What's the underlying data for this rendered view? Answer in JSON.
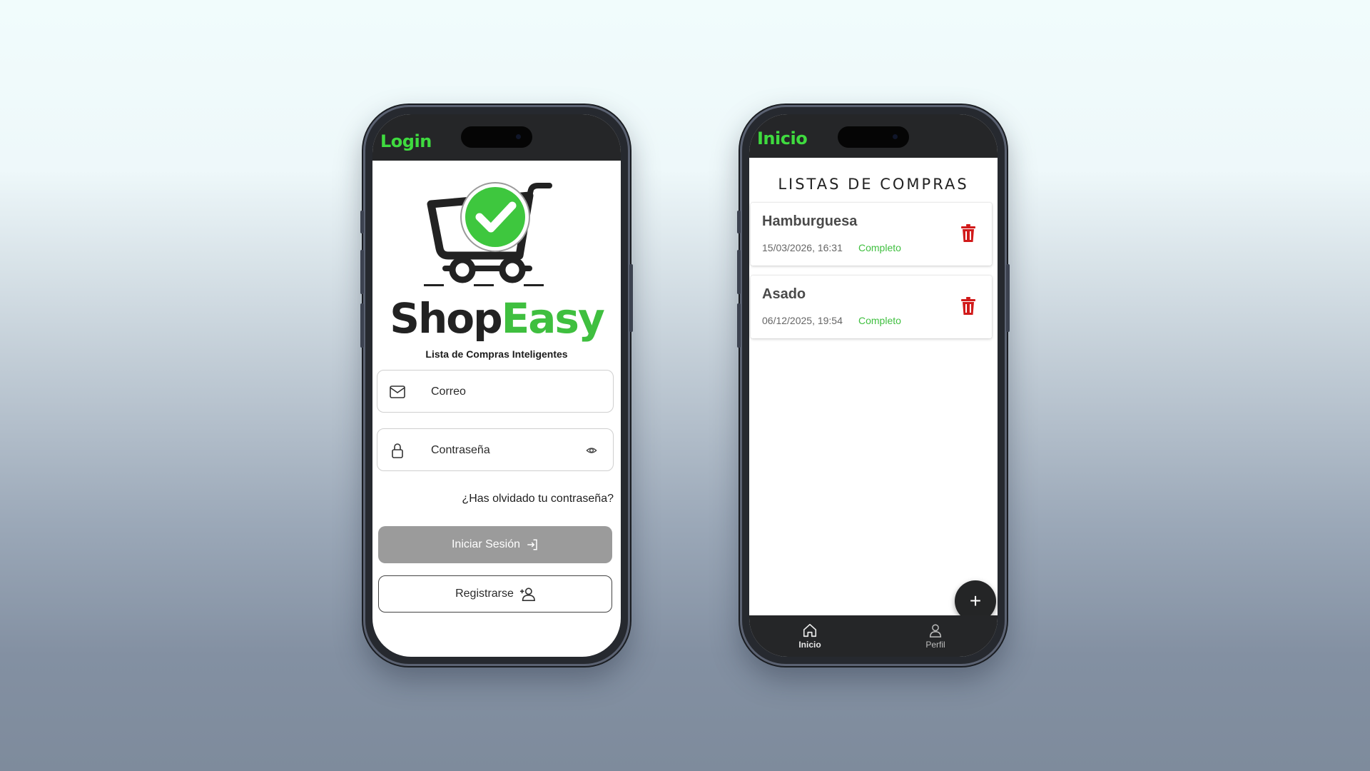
{
  "login_screen": {
    "header_title": "Login",
    "brand": {
      "part1": "Shop",
      "part2": "Easy",
      "tagline": "Lista de Compras Inteligentes"
    },
    "email_field": {
      "placeholder": "Correo",
      "icon": "mail-icon"
    },
    "password_field": {
      "placeholder": "Contraseña",
      "icon": "lock-icon",
      "toggle_icon": "eye-icon"
    },
    "forgot_link": "¿Has olvidado tu contraseña?",
    "login_button": "Iniciar Sesión",
    "register_button": "Registrarse"
  },
  "home_screen": {
    "header_title": "Inicio",
    "page_title": "LISTAS DE COMPRAS",
    "lists": [
      {
        "name": "Hamburguesa",
        "date": "15/03/2026, 16:31",
        "status": "Completo"
      },
      {
        "name": "Asado",
        "date": "06/12/2025, 19:54",
        "status": "Completo"
      }
    ],
    "fab_label": "+",
    "tabs": [
      {
        "label": "Inicio",
        "icon": "home-icon",
        "active": true
      },
      {
        "label": "Perfil",
        "icon": "user-icon",
        "active": false
      }
    ]
  },
  "colors": {
    "accent_green": "#3fdb3f",
    "status_green": "#3fbf3f",
    "delete_red": "#d11a1a",
    "dark_bar": "#252628"
  }
}
